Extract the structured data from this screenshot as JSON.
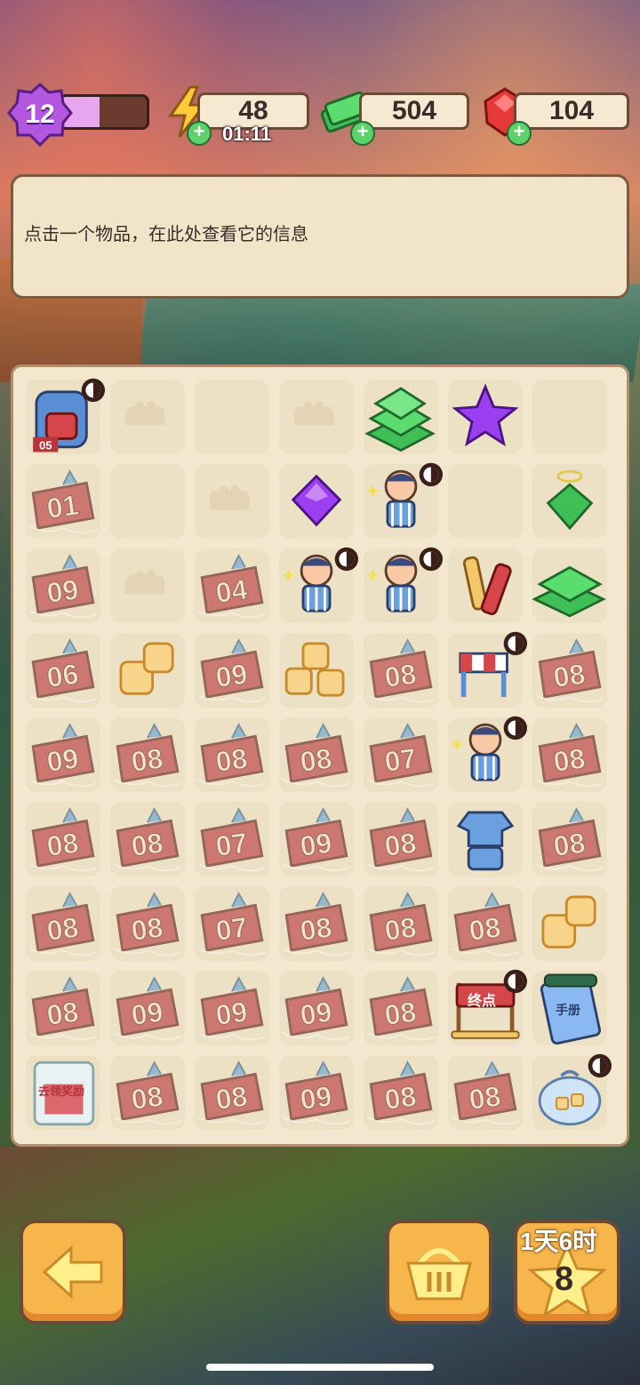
{
  "top_bar": {
    "level": "12",
    "level_progress": 0.45,
    "energy": "48",
    "energy_timer": "01:11",
    "cash": "504",
    "gems": "104"
  },
  "info_panel": {
    "hint": "点击一个物品，在此处查看它的信息"
  },
  "board": {
    "rows": 9,
    "cols": 7,
    "cells": [
      [
        "backpack-05",
        "empty-leaf",
        "empty",
        "empty-leaf",
        "cash-stack-large",
        "purple-star",
        "empty"
      ],
      [
        "ticket-01",
        "empty",
        "empty-leaf",
        "purple-gem",
        "runner-kid",
        "empty",
        "green-gem-ring"
      ],
      [
        "ticket-09",
        "empty-leaf",
        "ticket-04",
        "runner-kid",
        "runner-kid",
        "snack-sticks",
        "cash-stack"
      ],
      [
        "ticket-06",
        "candy-cubes-2",
        "ticket-09",
        "candy-cubes-3",
        "ticket-08",
        "hurdle",
        "ticket-08"
      ],
      [
        "ticket-09",
        "ticket-08",
        "ticket-08",
        "ticket-08",
        "ticket-07",
        "runner-kid",
        "ticket-08"
      ],
      [
        "ticket-08",
        "ticket-08",
        "ticket-07",
        "ticket-09",
        "ticket-08",
        "sports-uniform",
        "ticket-08"
      ],
      [
        "ticket-08",
        "ticket-08",
        "ticket-07",
        "ticket-08",
        "ticket-08",
        "ticket-08",
        "candy-cubes-2"
      ],
      [
        "ticket-08",
        "ticket-09",
        "ticket-09",
        "ticket-09",
        "ticket-08",
        "finish-line",
        "handbook"
      ],
      [
        "gift-box",
        "ticket-08",
        "ticket-08",
        "ticket-09",
        "ticket-08",
        "ticket-08",
        "candy-bag"
      ]
    ],
    "locked_tickets": true
  },
  "labels": {
    "finish": "终点",
    "handbook": "手册",
    "gift": "去领奖励"
  },
  "bottom_bar": {
    "star_timer": "1天6时",
    "star_count": "8"
  },
  "colors": {
    "panel": "#f2e4c9",
    "board": "#f3e7cf",
    "button": "#f6b64b",
    "ticket": "#b8343a"
  }
}
